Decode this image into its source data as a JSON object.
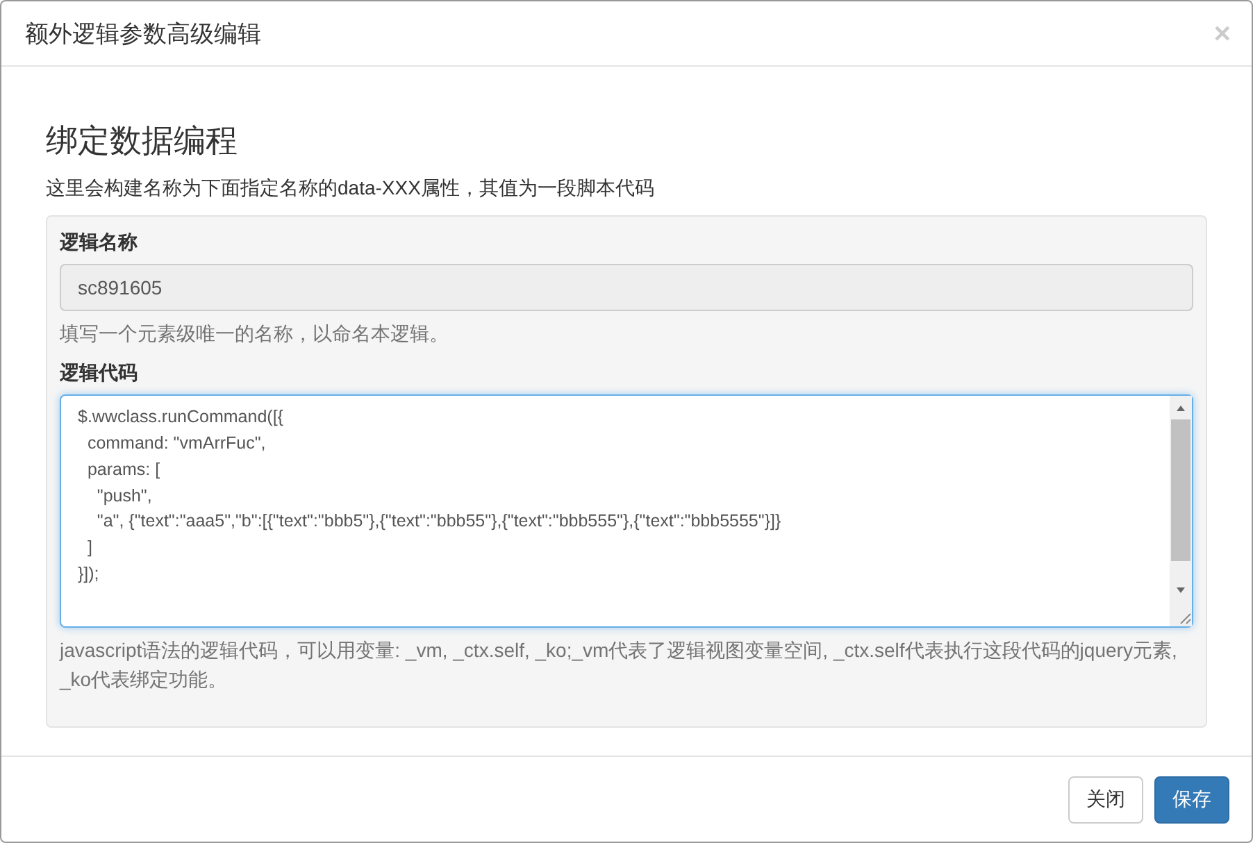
{
  "dialog": {
    "title": "额外逻辑参数高级编辑",
    "close": "×"
  },
  "section": {
    "heading": "绑定数据编程",
    "description": "这里会构建名称为下面指定名称的data-XXX属性，其值为一段脚本代码"
  },
  "name_field": {
    "label": "逻辑名称",
    "value": "sc891605",
    "disabled": true,
    "help": "填写一个元素级唯一的名称，以命名本逻辑。"
  },
  "code_field": {
    "label": "逻辑代码",
    "value": "$.wwclass.runCommand([{\n  command: \"vmArrFuc\",\n  params: [\n    \"push\",\n    \"a\", {\"text\":\"aaa5\",\"b\":[{\"text\":\"bbb5\"},{\"text\":\"bbb55\"},{\"text\":\"bbb555\"},{\"text\":\"bbb5555\"}]}\n  ]\n}]);",
    "focused": true,
    "help": "javascript语法的逻辑代码，可以用变量: _vm, _ctx.self, _ko;_vm代表了逻辑视图变量空间, _ctx.self代表执行这段代码的jquery元素, _ko代表绑定功能。"
  },
  "buttons": [
    {
      "label": "关闭",
      "kind": "default"
    },
    {
      "label": "保存",
      "kind": "primary"
    }
  ]
}
